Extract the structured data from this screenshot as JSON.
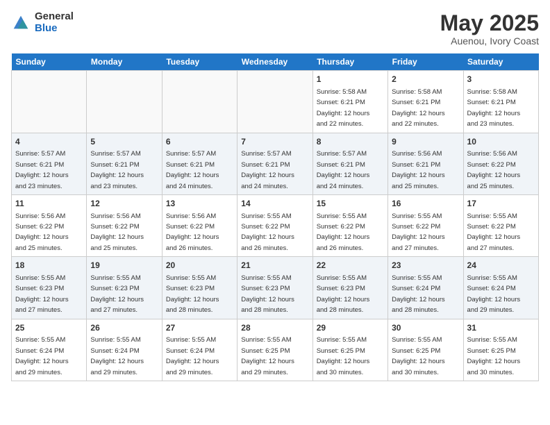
{
  "logo": {
    "general": "General",
    "blue": "Blue"
  },
  "header": {
    "title": "May 2025",
    "subtitle": "Auenou, Ivory Coast"
  },
  "days_of_week": [
    "Sunday",
    "Monday",
    "Tuesday",
    "Wednesday",
    "Thursday",
    "Friday",
    "Saturday"
  ],
  "weeks": [
    [
      {
        "day": "",
        "info": ""
      },
      {
        "day": "",
        "info": ""
      },
      {
        "day": "",
        "info": ""
      },
      {
        "day": "",
        "info": ""
      },
      {
        "day": "1",
        "info": "Sunrise: 5:58 AM\nSunset: 6:21 PM\nDaylight: 12 hours\nand 22 minutes."
      },
      {
        "day": "2",
        "info": "Sunrise: 5:58 AM\nSunset: 6:21 PM\nDaylight: 12 hours\nand 22 minutes."
      },
      {
        "day": "3",
        "info": "Sunrise: 5:58 AM\nSunset: 6:21 PM\nDaylight: 12 hours\nand 23 minutes."
      }
    ],
    [
      {
        "day": "4",
        "info": "Sunrise: 5:57 AM\nSunset: 6:21 PM\nDaylight: 12 hours\nand 23 minutes."
      },
      {
        "day": "5",
        "info": "Sunrise: 5:57 AM\nSunset: 6:21 PM\nDaylight: 12 hours\nand 23 minutes."
      },
      {
        "day": "6",
        "info": "Sunrise: 5:57 AM\nSunset: 6:21 PM\nDaylight: 12 hours\nand 24 minutes."
      },
      {
        "day": "7",
        "info": "Sunrise: 5:57 AM\nSunset: 6:21 PM\nDaylight: 12 hours\nand 24 minutes."
      },
      {
        "day": "8",
        "info": "Sunrise: 5:57 AM\nSunset: 6:21 PM\nDaylight: 12 hours\nand 24 minutes."
      },
      {
        "day": "9",
        "info": "Sunrise: 5:56 AM\nSunset: 6:21 PM\nDaylight: 12 hours\nand 25 minutes."
      },
      {
        "day": "10",
        "info": "Sunrise: 5:56 AM\nSunset: 6:22 PM\nDaylight: 12 hours\nand 25 minutes."
      }
    ],
    [
      {
        "day": "11",
        "info": "Sunrise: 5:56 AM\nSunset: 6:22 PM\nDaylight: 12 hours\nand 25 minutes."
      },
      {
        "day": "12",
        "info": "Sunrise: 5:56 AM\nSunset: 6:22 PM\nDaylight: 12 hours\nand 25 minutes."
      },
      {
        "day": "13",
        "info": "Sunrise: 5:56 AM\nSunset: 6:22 PM\nDaylight: 12 hours\nand 26 minutes."
      },
      {
        "day": "14",
        "info": "Sunrise: 5:55 AM\nSunset: 6:22 PM\nDaylight: 12 hours\nand 26 minutes."
      },
      {
        "day": "15",
        "info": "Sunrise: 5:55 AM\nSunset: 6:22 PM\nDaylight: 12 hours\nand 26 minutes."
      },
      {
        "day": "16",
        "info": "Sunrise: 5:55 AM\nSunset: 6:22 PM\nDaylight: 12 hours\nand 27 minutes."
      },
      {
        "day": "17",
        "info": "Sunrise: 5:55 AM\nSunset: 6:22 PM\nDaylight: 12 hours\nand 27 minutes."
      }
    ],
    [
      {
        "day": "18",
        "info": "Sunrise: 5:55 AM\nSunset: 6:23 PM\nDaylight: 12 hours\nand 27 minutes."
      },
      {
        "day": "19",
        "info": "Sunrise: 5:55 AM\nSunset: 6:23 PM\nDaylight: 12 hours\nand 27 minutes."
      },
      {
        "day": "20",
        "info": "Sunrise: 5:55 AM\nSunset: 6:23 PM\nDaylight: 12 hours\nand 28 minutes."
      },
      {
        "day": "21",
        "info": "Sunrise: 5:55 AM\nSunset: 6:23 PM\nDaylight: 12 hours\nand 28 minutes."
      },
      {
        "day": "22",
        "info": "Sunrise: 5:55 AM\nSunset: 6:23 PM\nDaylight: 12 hours\nand 28 minutes."
      },
      {
        "day": "23",
        "info": "Sunrise: 5:55 AM\nSunset: 6:24 PM\nDaylight: 12 hours\nand 28 minutes."
      },
      {
        "day": "24",
        "info": "Sunrise: 5:55 AM\nSunset: 6:24 PM\nDaylight: 12 hours\nand 29 minutes."
      }
    ],
    [
      {
        "day": "25",
        "info": "Sunrise: 5:55 AM\nSunset: 6:24 PM\nDaylight: 12 hours\nand 29 minutes."
      },
      {
        "day": "26",
        "info": "Sunrise: 5:55 AM\nSunset: 6:24 PM\nDaylight: 12 hours\nand 29 minutes."
      },
      {
        "day": "27",
        "info": "Sunrise: 5:55 AM\nSunset: 6:24 PM\nDaylight: 12 hours\nand 29 minutes."
      },
      {
        "day": "28",
        "info": "Sunrise: 5:55 AM\nSunset: 6:25 PM\nDaylight: 12 hours\nand 29 minutes."
      },
      {
        "day": "29",
        "info": "Sunrise: 5:55 AM\nSunset: 6:25 PM\nDaylight: 12 hours\nand 30 minutes."
      },
      {
        "day": "30",
        "info": "Sunrise: 5:55 AM\nSunset: 6:25 PM\nDaylight: 12 hours\nand 30 minutes."
      },
      {
        "day": "31",
        "info": "Sunrise: 5:55 AM\nSunset: 6:25 PM\nDaylight: 12 hours\nand 30 minutes."
      }
    ]
  ]
}
